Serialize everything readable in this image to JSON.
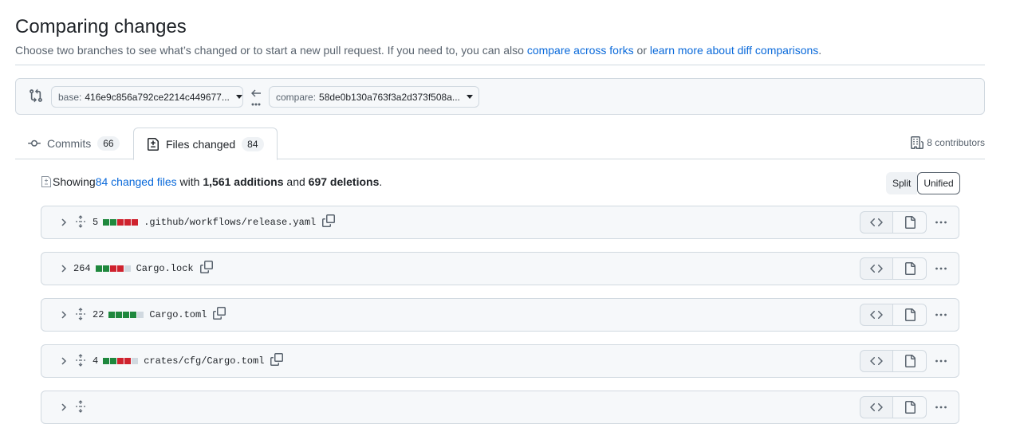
{
  "header": {
    "title": "Comparing changes",
    "desc_prefix": "Choose two branches to see what’s changed or to start a new pull request. If you need to, you can also ",
    "link_forks": "compare across forks",
    "desc_or": " or ",
    "link_learn": "learn more about diff comparisons",
    "desc_suffix": "."
  },
  "range": {
    "base_label": "base:",
    "base_value": "416e9c856a792ce2214c449677...",
    "compare_label": "compare:",
    "compare_value": "58de0b130a763f3a2d373f508a...",
    "dots": "..."
  },
  "tabs": [
    {
      "label": "Commits",
      "count": "66",
      "icon": "commit-icon"
    },
    {
      "label": "Files changed",
      "count": "84",
      "icon": "file-diff-icon"
    }
  ],
  "contributors": "8 contributors",
  "summary": {
    "prefix": "Showing ",
    "files_link": "84 changed files",
    "with": " with ",
    "additions": "1,561 additions",
    "and": " and ",
    "deletions": "697 deletions",
    "end": "."
  },
  "view_toggle": {
    "split": "Split",
    "unified": "Unified",
    "selected": "Unified"
  },
  "colors": {
    "addition": "#1f883d",
    "deletion": "#cf222e",
    "neutral": "#d1d9e0",
    "link": "#0969da"
  },
  "files": [
    {
      "count": "5",
      "name": ".github/workflows/release.yaml",
      "expandable": true,
      "diffstat": [
        "add",
        "add",
        "del",
        "del",
        "del"
      ]
    },
    {
      "count": "264",
      "name": "Cargo.lock",
      "expandable": false,
      "diffstat": [
        "add",
        "add",
        "del",
        "del",
        "neutral"
      ]
    },
    {
      "count": "22",
      "name": "Cargo.toml",
      "expandable": true,
      "diffstat": [
        "add",
        "add",
        "add",
        "add",
        "neutral"
      ]
    },
    {
      "count": "4",
      "name": "crates/cfg/Cargo.toml",
      "expandable": true,
      "diffstat": [
        "add",
        "add",
        "del",
        "del",
        "neutral"
      ]
    },
    {
      "count": "",
      "name": "",
      "expandable": true,
      "diffstat": []
    }
  ]
}
